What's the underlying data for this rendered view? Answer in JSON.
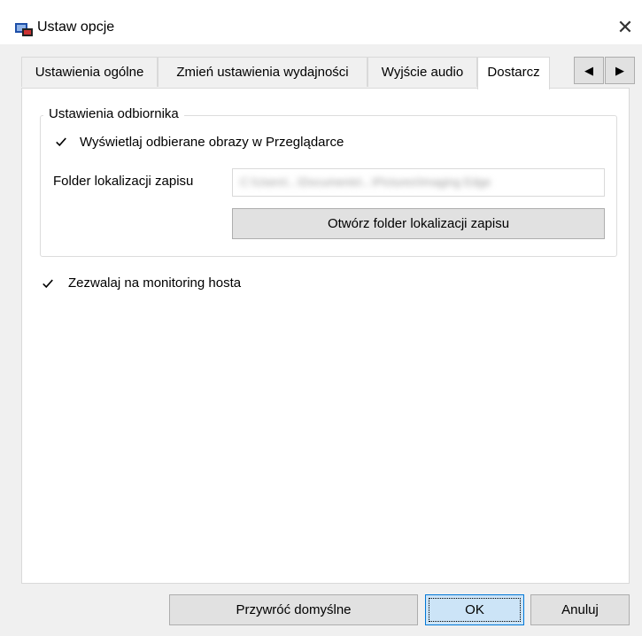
{
  "window": {
    "title": "Ustaw opcje",
    "close_glyph": "✕"
  },
  "tabs": [
    {
      "label": "Ustawienia ogólne"
    },
    {
      "label": "Zmień ustawienia wydajności"
    },
    {
      "label": "Wyjście audio"
    },
    {
      "label": "Dostarcz"
    }
  ],
  "tab_scroll": {
    "left_glyph": "◀",
    "right_glyph": "▶"
  },
  "receiver_group": {
    "label": "Ustawienia odbiornika",
    "show_images_checkbox": {
      "label": "Wyświetlaj odbierane obrazy w Przeglądarce",
      "checked": true
    },
    "save_folder_label": "Folder lokalizacji zapisu",
    "save_folder_value": "C:\\Users\\...\\Documents\\...\\Pictures\\Imaging Edge",
    "open_folder_button": "Otwórz folder lokalizacji zapisu"
  },
  "host_monitoring_checkbox": {
    "label": "Zezwalaj na monitoring hosta",
    "checked": true
  },
  "footer": {
    "restore_defaults": "Przywróć domyślne",
    "ok": "OK",
    "cancel": "Anuluj"
  },
  "colors": {
    "accent": "#0078d7",
    "tab_active_bg": "#ffffff",
    "dialog_bg": "#f0f0f0"
  }
}
